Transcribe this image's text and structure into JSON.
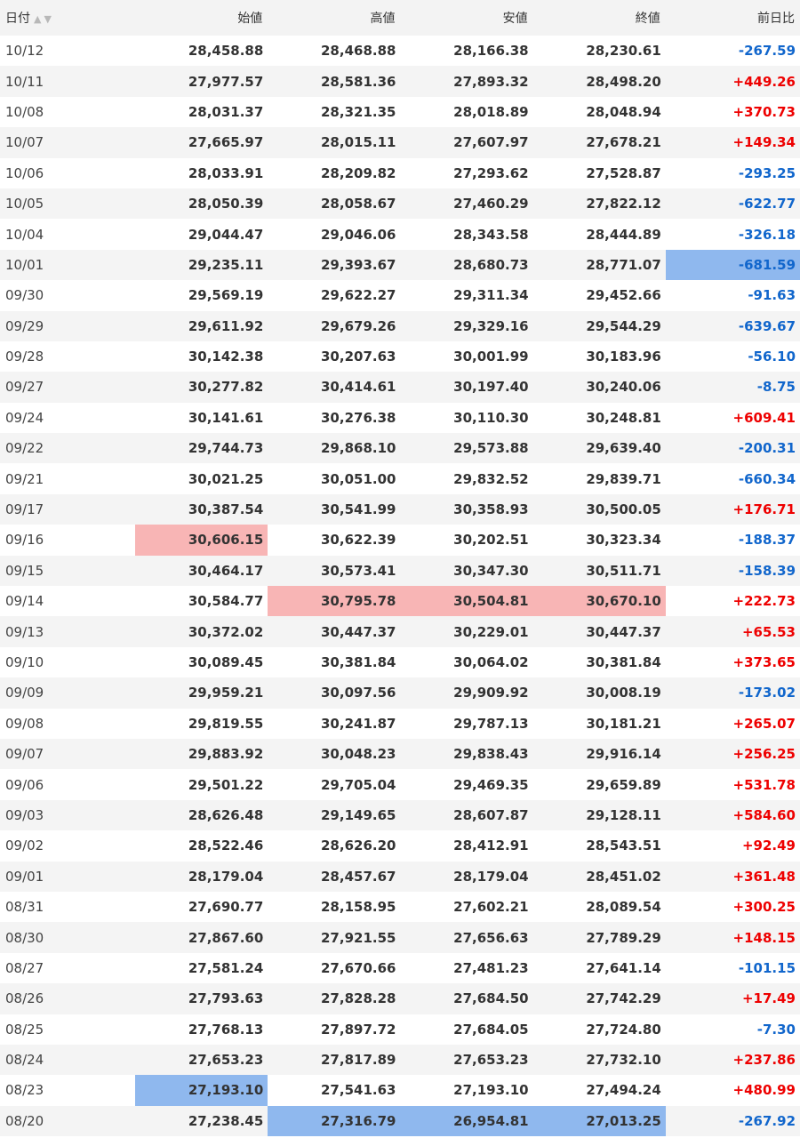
{
  "headers": {
    "date": "日付",
    "open": "始値",
    "high": "高値",
    "low": "安値",
    "close": "終値",
    "change": "前日比"
  },
  "colors": {
    "positive": "#ee0000",
    "negative": "#1166cc",
    "high_highlight": "#f8b5b5",
    "low_highlight": "#8fb8ee"
  },
  "rows": [
    {
      "date": "10/12",
      "open": "28,458.88",
      "high": "28,468.88",
      "low": "28,166.38",
      "close": "28,230.61",
      "change": "-267.59"
    },
    {
      "date": "10/11",
      "open": "27,977.57",
      "high": "28,581.36",
      "low": "27,893.32",
      "close": "28,498.20",
      "change": "+449.26"
    },
    {
      "date": "10/08",
      "open": "28,031.37",
      "high": "28,321.35",
      "low": "28,018.89",
      "close": "28,048.94",
      "change": "+370.73"
    },
    {
      "date": "10/07",
      "open": "27,665.97",
      "high": "28,015.11",
      "low": "27,607.97",
      "close": "27,678.21",
      "change": "+149.34"
    },
    {
      "date": "10/06",
      "open": "28,033.91",
      "high": "28,209.82",
      "low": "27,293.62",
      "close": "27,528.87",
      "change": "-293.25"
    },
    {
      "date": "10/05",
      "open": "28,050.39",
      "high": "28,058.67",
      "low": "27,460.29",
      "close": "27,822.12",
      "change": "-622.77"
    },
    {
      "date": "10/04",
      "open": "29,044.47",
      "high": "29,046.06",
      "low": "28,343.58",
      "close": "28,444.89",
      "change": "-326.18"
    },
    {
      "date": "10/01",
      "open": "29,235.11",
      "high": "29,393.67",
      "low": "28,680.73",
      "close": "28,771.07",
      "change": "-681.59",
      "hl": {
        "change": "lo"
      }
    },
    {
      "date": "09/30",
      "open": "29,569.19",
      "high": "29,622.27",
      "low": "29,311.34",
      "close": "29,452.66",
      "change": "-91.63"
    },
    {
      "date": "09/29",
      "open": "29,611.92",
      "high": "29,679.26",
      "low": "29,329.16",
      "close": "29,544.29",
      "change": "-639.67"
    },
    {
      "date": "09/28",
      "open": "30,142.38",
      "high": "30,207.63",
      "low": "30,001.99",
      "close": "30,183.96",
      "change": "-56.10"
    },
    {
      "date": "09/27",
      "open": "30,277.82",
      "high": "30,414.61",
      "low": "30,197.40",
      "close": "30,240.06",
      "change": "-8.75"
    },
    {
      "date": "09/24",
      "open": "30,141.61",
      "high": "30,276.38",
      "low": "30,110.30",
      "close": "30,248.81",
      "change": "+609.41"
    },
    {
      "date": "09/22",
      "open": "29,744.73",
      "high": "29,868.10",
      "low": "29,573.88",
      "close": "29,639.40",
      "change": "-200.31"
    },
    {
      "date": "09/21",
      "open": "30,021.25",
      "high": "30,051.00",
      "low": "29,832.52",
      "close": "29,839.71",
      "change": "-660.34"
    },
    {
      "date": "09/17",
      "open": "30,387.54",
      "high": "30,541.99",
      "low": "30,358.93",
      "close": "30,500.05",
      "change": "+176.71"
    },
    {
      "date": "09/16",
      "open": "30,606.15",
      "high": "30,622.39",
      "low": "30,202.51",
      "close": "30,323.34",
      "change": "-188.37",
      "hl": {
        "open": "hi"
      }
    },
    {
      "date": "09/15",
      "open": "30,464.17",
      "high": "30,573.41",
      "low": "30,347.30",
      "close": "30,511.71",
      "change": "-158.39"
    },
    {
      "date": "09/14",
      "open": "30,584.77",
      "high": "30,795.78",
      "low": "30,504.81",
      "close": "30,670.10",
      "change": "+222.73",
      "hl": {
        "high": "hi",
        "low": "hi",
        "close": "hi"
      }
    },
    {
      "date": "09/13",
      "open": "30,372.02",
      "high": "30,447.37",
      "low": "30,229.01",
      "close": "30,447.37",
      "change": "+65.53"
    },
    {
      "date": "09/10",
      "open": "30,089.45",
      "high": "30,381.84",
      "low": "30,064.02",
      "close": "30,381.84",
      "change": "+373.65"
    },
    {
      "date": "09/09",
      "open": "29,959.21",
      "high": "30,097.56",
      "low": "29,909.92",
      "close": "30,008.19",
      "change": "-173.02"
    },
    {
      "date": "09/08",
      "open": "29,819.55",
      "high": "30,241.87",
      "low": "29,787.13",
      "close": "30,181.21",
      "change": "+265.07"
    },
    {
      "date": "09/07",
      "open": "29,883.92",
      "high": "30,048.23",
      "low": "29,838.43",
      "close": "29,916.14",
      "change": "+256.25"
    },
    {
      "date": "09/06",
      "open": "29,501.22",
      "high": "29,705.04",
      "low": "29,469.35",
      "close": "29,659.89",
      "change": "+531.78"
    },
    {
      "date": "09/03",
      "open": "28,626.48",
      "high": "29,149.65",
      "low": "28,607.87",
      "close": "29,128.11",
      "change": "+584.60"
    },
    {
      "date": "09/02",
      "open": "28,522.46",
      "high": "28,626.20",
      "low": "28,412.91",
      "close": "28,543.51",
      "change": "+92.49"
    },
    {
      "date": "09/01",
      "open": "28,179.04",
      "high": "28,457.67",
      "low": "28,179.04",
      "close": "28,451.02",
      "change": "+361.48"
    },
    {
      "date": "08/31",
      "open": "27,690.77",
      "high": "28,158.95",
      "low": "27,602.21",
      "close": "28,089.54",
      "change": "+300.25"
    },
    {
      "date": "08/30",
      "open": "27,867.60",
      "high": "27,921.55",
      "low": "27,656.63",
      "close": "27,789.29",
      "change": "+148.15"
    },
    {
      "date": "08/27",
      "open": "27,581.24",
      "high": "27,670.66",
      "low": "27,481.23",
      "close": "27,641.14",
      "change": "-101.15"
    },
    {
      "date": "08/26",
      "open": "27,793.63",
      "high": "27,828.28",
      "low": "27,684.50",
      "close": "27,742.29",
      "change": "+17.49"
    },
    {
      "date": "08/25",
      "open": "27,768.13",
      "high": "27,897.72",
      "low": "27,684.05",
      "close": "27,724.80",
      "change": "-7.30"
    },
    {
      "date": "08/24",
      "open": "27,653.23",
      "high": "27,817.89",
      "low": "27,653.23",
      "close": "27,732.10",
      "change": "+237.86"
    },
    {
      "date": "08/23",
      "open": "27,193.10",
      "high": "27,541.63",
      "low": "27,193.10",
      "close": "27,494.24",
      "change": "+480.99",
      "hl": {
        "open": "lo"
      }
    },
    {
      "date": "08/20",
      "open": "27,238.45",
      "high": "27,316.79",
      "low": "26,954.81",
      "close": "27,013.25",
      "change": "-267.92",
      "hl": {
        "high": "lo",
        "low": "lo",
        "close": "lo"
      }
    }
  ]
}
